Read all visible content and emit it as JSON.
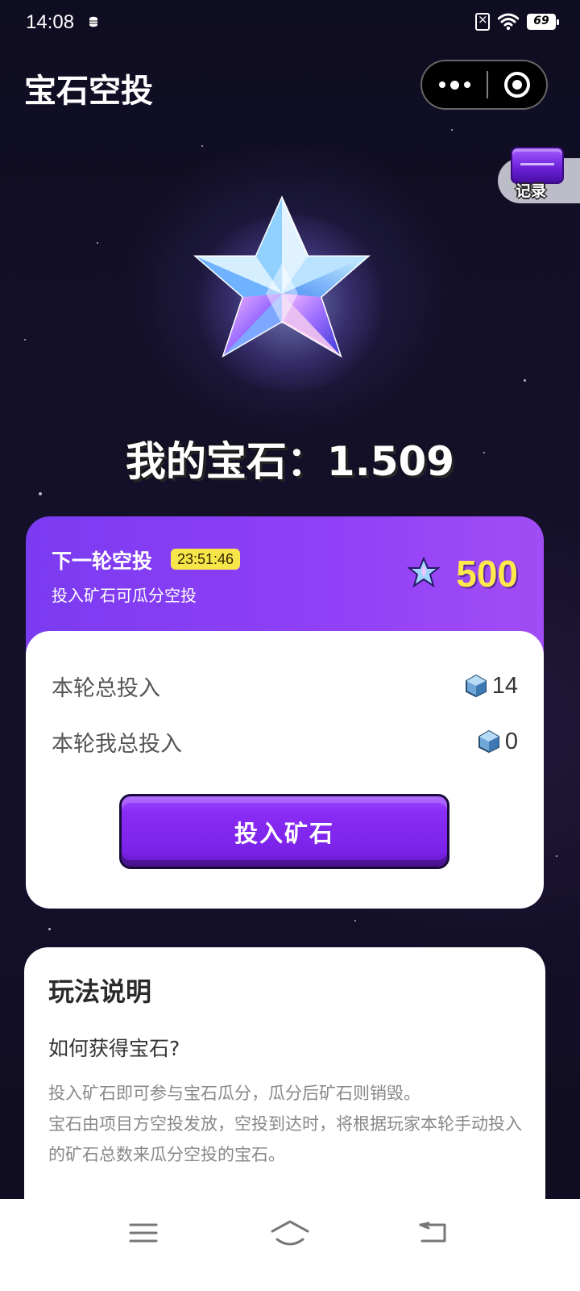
{
  "status_bar": {
    "time": "14:08",
    "battery": "69",
    "icons": [
      "database-icon",
      "sim-off-icon",
      "wifi-icon",
      "battery-icon"
    ]
  },
  "header": {
    "title": "宝石空投"
  },
  "records": {
    "label": "记录"
  },
  "my_gems": {
    "text": "我的宝石：1.509"
  },
  "airdrop": {
    "next_round_label": "下一轮空投",
    "countdown": "23:51:46",
    "subtitle": "投入矿石可瓜分空投",
    "reward_amount": "500",
    "total_invest_label": "本轮总投入",
    "total_invest_value": "14",
    "my_invest_label": "本轮我总投入",
    "my_invest_value": "0",
    "invest_button": "投入矿石"
  },
  "rules": {
    "title": "玩法说明",
    "question": "如何获得宝石?",
    "line1": "投入矿石即可参与宝石瓜分，瓜分后矿石则销毁。",
    "line2": "宝石由项目方空投发放，空投到达时，将根据玩家本轮手动投入的矿石总数来瓜分空投的宝石。"
  },
  "colors": {
    "accent_purple": "#8a2cf5",
    "reward_yellow": "#ffe94a",
    "countdown_yellow": "#f6e64a"
  }
}
